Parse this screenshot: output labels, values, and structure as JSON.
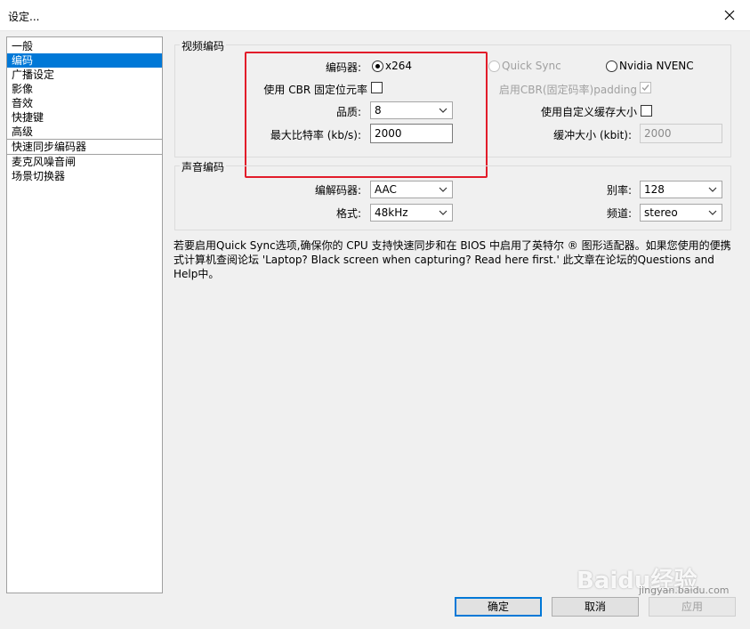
{
  "window": {
    "title": "设定..."
  },
  "sidebar": {
    "items": [
      {
        "label": "一般"
      },
      {
        "label": "编码"
      },
      {
        "label": "广播设定"
      },
      {
        "label": "影像"
      },
      {
        "label": "音效"
      },
      {
        "label": "快捷键"
      },
      {
        "label": "高级"
      },
      {
        "label": "快速同步编码器"
      },
      {
        "label": "麦克风噪音闸"
      },
      {
        "label": "场景切换器"
      }
    ],
    "selected": "编码"
  },
  "video": {
    "group_title": "视频编码",
    "encoder_label": "编码器:",
    "encoder_options": [
      "x264",
      "Quick Sync",
      "Nvidia NVENC"
    ],
    "encoder_selected": "x264",
    "cbr_label": "使用 CBR 固定位元率",
    "cbr_checked": false,
    "cbr_padding_label": "启用CBR(固定码率)padding",
    "cbr_padding_checked": true,
    "quality_label": "品质:",
    "quality_value": "8",
    "custom_buffer_label": "使用自定义缓存大小",
    "custom_buffer_checked": false,
    "max_bitrate_label": "最大比特率 (kb/s):",
    "max_bitrate_value": "2000",
    "buffer_size_label": "缓冲大小 (kbit):",
    "buffer_size_value": "2000"
  },
  "audio": {
    "group_title": "声音编码",
    "codec_label": "编解码器:",
    "codec_value": "AAC",
    "format_label": "格式:",
    "format_value": "48kHz",
    "bitrate_label": "别率:",
    "bitrate_value": "128",
    "channel_label": "频道:",
    "channel_value": "stereo"
  },
  "note": "若要启用Quick Sync选项,确保你的 CPU 支持快速同步和在 BIOS 中启用了英特尔 ® 图形适配器。如果您使用的便携式计算机查阅论坛 'Laptop? Black screen when capturing? Read here first.' 此文章在论坛的Questions and Help中。",
  "buttons": {
    "ok": "确定",
    "cancel": "取消",
    "apply": "应用"
  },
  "watermark": {
    "brand": "Baidu经验",
    "url": "jingyan.baidu.com"
  },
  "colors": {
    "selection": "#0078d7",
    "highlight_box": "#e21c2a"
  }
}
